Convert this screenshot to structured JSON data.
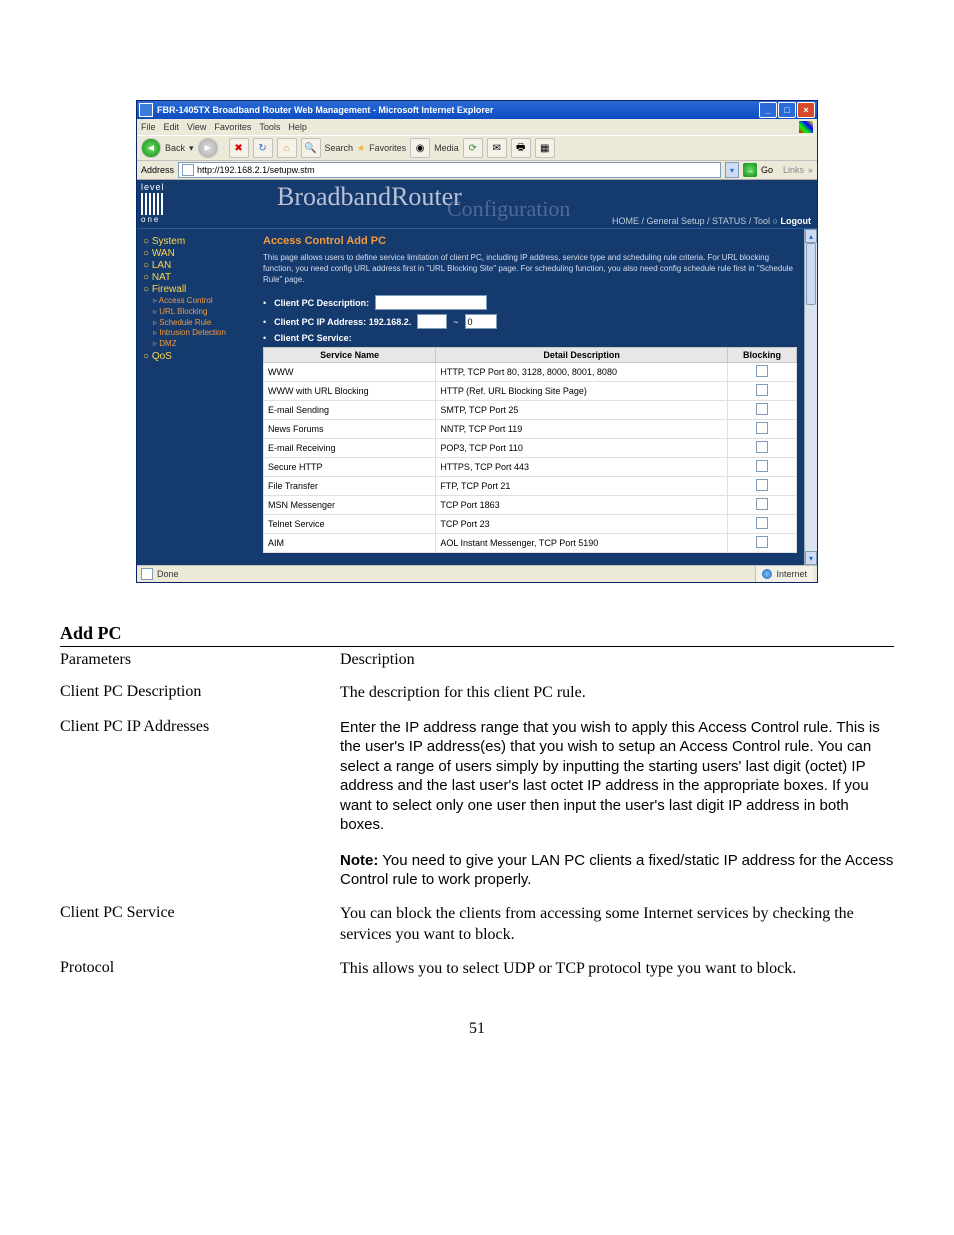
{
  "window": {
    "title": "FBR-1405TX Broadband Router Web Management - Microsoft Internet Explorer",
    "menus": [
      "File",
      "Edit",
      "View",
      "Favorites",
      "Tools",
      "Help"
    ],
    "back": "Back",
    "search": "Search",
    "favorites": "Favorites",
    "media": "Media",
    "address_label": "Address",
    "url": "http://192.168.2.1/setupw.stm",
    "go": "Go",
    "links": "Links",
    "status_done": "Done",
    "status_zone": "Internet"
  },
  "router": {
    "logo_top": "level",
    "logo_bottom": "one",
    "brand1": "BroadbandRouter",
    "brand2": "Configuration",
    "nav": "HOME / General Setup / STATUS / Tool  ○",
    "logout": "Logout",
    "sidebar": {
      "main": [
        "System",
        "WAN",
        "LAN",
        "NAT",
        "Firewall"
      ],
      "subs": [
        "Access Control",
        "URL Blocking",
        "Schedule Rule",
        "Intrusion Detection",
        "DMZ"
      ],
      "last": "QoS"
    },
    "content": {
      "heading": "Access Control Add PC",
      "intro": "This page allows users to define service limitation of client PC, including IP address, service type and scheduling rule criteria. For URL blocking function, you need config URL address first in \"URL Blocking Site\" page. For scheduling function, you also need config schedule rule first in \"Schedule Rule\" page.",
      "desc_label": "Client PC Description:",
      "ip_label": "Client PC IP Address:",
      "ip_prefix": "192.168.2.",
      "ip_sep": "~",
      "ip_val": "0",
      "svc_label": "Client PC Service:",
      "th1": "Service Name",
      "th2": "Detail Description",
      "th3": "Blocking",
      "rows": [
        {
          "n": "WWW",
          "d": "HTTP, TCP Port 80, 3128, 8000, 8001, 8080"
        },
        {
          "n": "WWW with URL Blocking",
          "d": "HTTP (Ref. URL Blocking Site Page)"
        },
        {
          "n": "E-mail Sending",
          "d": "SMTP, TCP Port 25"
        },
        {
          "n": "News Forums",
          "d": "NNTP, TCP Port 119"
        },
        {
          "n": "E-mail Receiving",
          "d": "POP3, TCP Port 110"
        },
        {
          "n": "Secure HTTP",
          "d": "HTTPS, TCP Port 443"
        },
        {
          "n": "File Transfer",
          "d": "FTP, TCP Port 21"
        },
        {
          "n": "MSN Messenger",
          "d": "TCP Port 1863"
        },
        {
          "n": "Telnet Service",
          "d": "TCP Port 23"
        },
        {
          "n": "AIM",
          "d": "AOL Instant Messenger, TCP Port 5190"
        }
      ]
    }
  },
  "doc": {
    "title": "Add PC",
    "h_param": "Parameters",
    "h_desc": "Description",
    "rows": [
      {
        "p": "Client PC Description",
        "d": "The description for this client PC rule.",
        "serif": true
      },
      {
        "p": "Client PC IP Addresses",
        "d": "Enter the IP address range that you wish to apply this Access Control rule. This is the user's IP address(es) that you wish to setup an Access Control rule. You can select a range of users simply by inputting the starting users' last digit (octet) IP address and the last user's last octet IP address in the appropriate boxes. If you want to select only one user then input the user's last digit IP address in both boxes."
      },
      {
        "p": "Client PC Service",
        "d": "You can block the clients from accessing some Internet services by checking the services you want to block.",
        "serif": true
      },
      {
        "p": "Protocol",
        "d": "This allows you to select UDP or TCP protocol type you want to block.",
        "serif": true
      }
    ],
    "note_label": "Note:",
    "note_text": " You need to give your LAN PC clients a fixed/static IP address for the Access Control rule to work properly.",
    "page": "51"
  }
}
